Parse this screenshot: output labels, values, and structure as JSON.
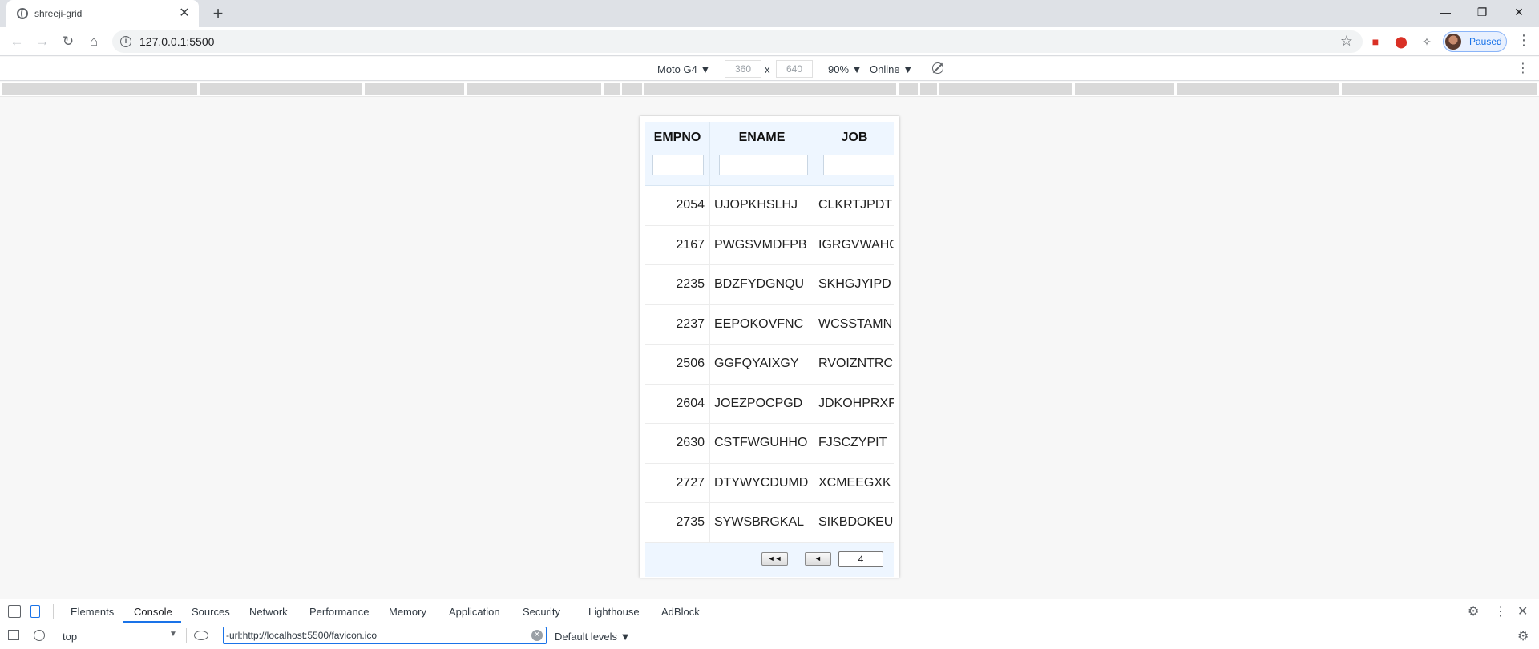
{
  "browser": {
    "tab_title": "shreeji-grid",
    "url": "127.0.0.1:5500",
    "profile_label": "Paused",
    "new_tab_symbol": "+",
    "tab_close_symbol": "✕"
  },
  "device_toolbar": {
    "device": "Moto G4",
    "width": "360",
    "height": "640",
    "times": "x",
    "zoom": "90%",
    "network": "Online"
  },
  "grid": {
    "columns": [
      "EMPNO",
      "ENAME",
      "JOB"
    ],
    "rows": [
      {
        "empno": "2054",
        "ename": "UJOPKHSLHJ",
        "job": "CLKRTJPDT"
      },
      {
        "empno": "2167",
        "ename": "PWGSVMDFPB",
        "job": "IGRGVWAHG"
      },
      {
        "empno": "2235",
        "ename": "BDZFYDGNQU",
        "job": "SKHGJYIPD"
      },
      {
        "empno": "2237",
        "ename": "EEPOKOVFNC",
        "job": "WCSSTAMN"
      },
      {
        "empno": "2506",
        "ename": "GGFQYAIXGY",
        "job": "RVOIZNTRC"
      },
      {
        "empno": "2604",
        "ename": "JOEZPOCPGD",
        "job": "JDKOHPRXF"
      },
      {
        "empno": "2630",
        "ename": "CSTFWGUHHO",
        "job": "FJSCZYPIT"
      },
      {
        "empno": "2727",
        "ename": "DTYWYCDUMD",
        "job": "XCMEEGXK"
      },
      {
        "empno": "2735",
        "ename": "SYWSBRGKAL",
        "job": "SIKBDOKEU"
      }
    ],
    "pager": {
      "first_label": "◄◄",
      "prev_label": "◄",
      "page": "4"
    }
  },
  "devtools": {
    "tabs": [
      "Elements",
      "Console",
      "Sources",
      "Network",
      "Performance",
      "Memory",
      "Application",
      "Security",
      "Lighthouse",
      "AdBlock"
    ],
    "active_tab": "Console",
    "context": "top",
    "filter_value": "-url:http://localhost:5500/favicon.ico",
    "levels": "Default levels"
  },
  "colors": {
    "grid_header_bg": "#eef6ff",
    "active_tab_underline": "#1a73e8"
  }
}
